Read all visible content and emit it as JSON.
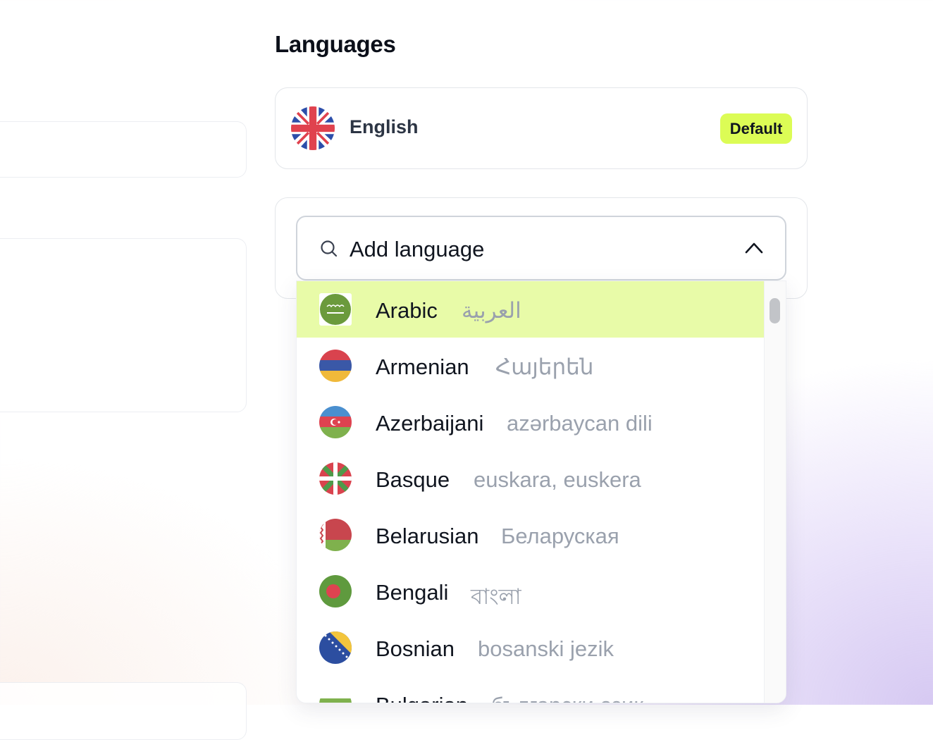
{
  "section": {
    "title": "Languages"
  },
  "default_language": {
    "name": "English",
    "badge": "Default",
    "flag_icon": "uk-flag-icon"
  },
  "add_language": {
    "placeholder": "Add language"
  },
  "languages": [
    {
      "name": "Arabic",
      "native": "العربية",
      "flag_icon": "saudi-arabia-flag-icon",
      "selected": true
    },
    {
      "name": "Armenian",
      "native": "Հայերեն",
      "flag_icon": "armenia-flag-icon"
    },
    {
      "name": "Azerbaijani",
      "native": "azərbaycan dili",
      "flag_icon": "azerbaijan-flag-icon"
    },
    {
      "name": "Basque",
      "native": "euskara, euskera",
      "flag_icon": "basque-flag-icon"
    },
    {
      "name": "Belarusian",
      "native": "Беларуская",
      "flag_icon": "belarus-flag-icon"
    },
    {
      "name": "Bengali",
      "native": "বাংলা",
      "flag_icon": "bangladesh-flag-icon"
    },
    {
      "name": "Bosnian",
      "native": "bosanski jezik",
      "flag_icon": "bosnia-flag-icon"
    },
    {
      "name": "Bulgarian",
      "native": "български език",
      "flag_icon": "bulgaria-flag-icon"
    }
  ],
  "colors": {
    "accent": "#dcfc55",
    "highlight": "#e8fba8",
    "muted_text": "#9aa1ad"
  }
}
